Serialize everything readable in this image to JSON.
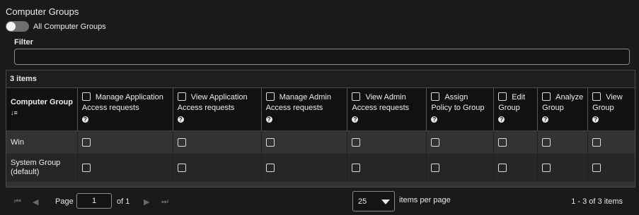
{
  "page": {
    "title": "Computer Groups"
  },
  "toggle": {
    "label": "All Computer Groups",
    "on": false
  },
  "filter": {
    "label": "Filter",
    "value": "",
    "placeholder": ""
  },
  "grid": {
    "count_label": "3 items",
    "first_column": "Computer Group",
    "sort_icon": "sort-descending-icon",
    "columns": [
      {
        "label": "Manage Application Access requests"
      },
      {
        "label": "View Application Access requests"
      },
      {
        "label": "Manage Admin Access requests"
      },
      {
        "label": "View Admin Access requests"
      },
      {
        "label": "Assign Policy to Group"
      },
      {
        "label": "Edit Group"
      },
      {
        "label": "Analyze Group"
      },
      {
        "label": "View Group"
      }
    ],
    "help_glyph": "?",
    "rows": [
      {
        "name": "Win",
        "checks": [
          false,
          false,
          false,
          false,
          false,
          false,
          false,
          false
        ]
      },
      {
        "name": "System Group (default)",
        "checks": [
          false,
          false,
          false,
          false,
          false,
          false,
          false,
          false
        ]
      }
    ]
  },
  "pager": {
    "first_icon": "⏮",
    "prev_icon": "◀",
    "next_icon": "▶",
    "last_icon": "⏭",
    "page_label": "Page",
    "page_value": "1",
    "of_label": "of 1",
    "per_page_value": "25",
    "per_page_label": "items per page",
    "range_label": "1 - 3 of 3 items"
  }
}
